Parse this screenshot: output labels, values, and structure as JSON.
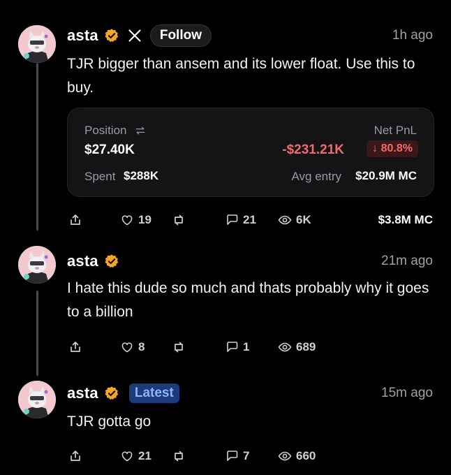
{
  "posts": [
    {
      "author": "asta",
      "follow_label": "Follow",
      "time": "1h ago",
      "text": "TJR bigger than ansem and its lower float. Use this to buy.",
      "card": {
        "position_label": "Position",
        "position_value": "$27.40K",
        "netpnl_label": "Net PnL",
        "netpnl_value": "-$231.21K",
        "pct": "80.8%",
        "spent_label": "Spent",
        "spent_value": "$288K",
        "avg_label": "Avg entry",
        "avg_value": "$20.9M MC"
      },
      "likes": "19",
      "comments": "21",
      "views": "6K",
      "mc": "$3.8M MC"
    },
    {
      "author": "asta",
      "time": "21m ago",
      "text": "I hate this dude so much and thats probably why it goes to a billion",
      "likes": "8",
      "comments": "1",
      "views": "689"
    },
    {
      "author": "asta",
      "badge": "Latest",
      "time": "15m ago",
      "text": "TJR gotta go",
      "likes": "21",
      "comments": "7",
      "views": "660"
    }
  ],
  "icons": {
    "verified": "verified-badge-icon",
    "x": "x-logo-icon",
    "share": "share-icon",
    "like": "heart-icon",
    "repost": "repost-icon",
    "comment": "comment-icon",
    "views": "eye-icon",
    "swap": "swap-icon",
    "down": "arrow-down-icon"
  },
  "colors": {
    "background": "#000000",
    "negative": "#f36a6a",
    "verified": "#f5a623",
    "latest_bg": "#1d3a7a",
    "latest_text": "#8fb4ff"
  }
}
